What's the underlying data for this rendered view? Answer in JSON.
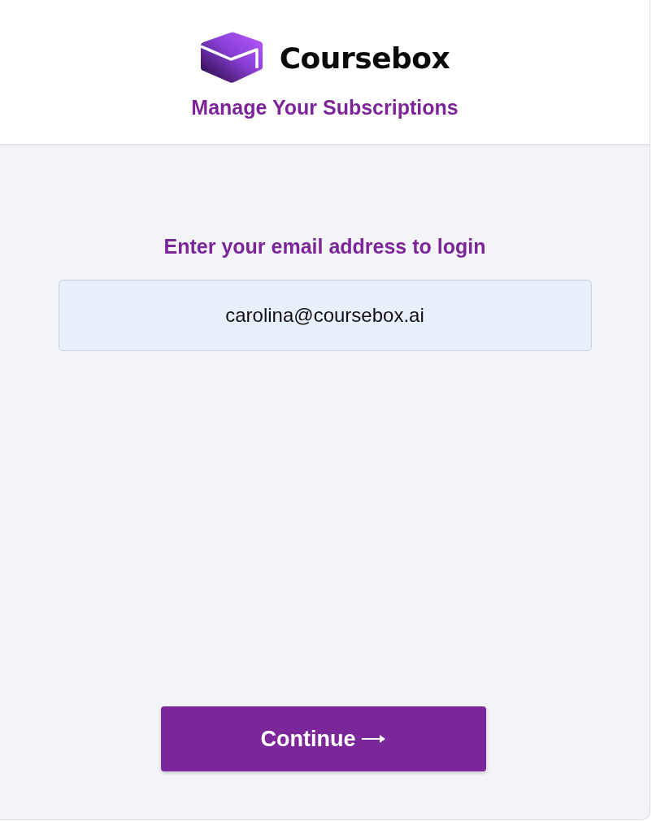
{
  "header": {
    "brand": "Coursebox",
    "subtitle": "Manage Your Subscriptions"
  },
  "login": {
    "prompt": "Enter your email address to login",
    "email_field": {
      "value": "carolina@coursebox.ai"
    }
  },
  "continue_button": {
    "label": "Continue"
  }
}
